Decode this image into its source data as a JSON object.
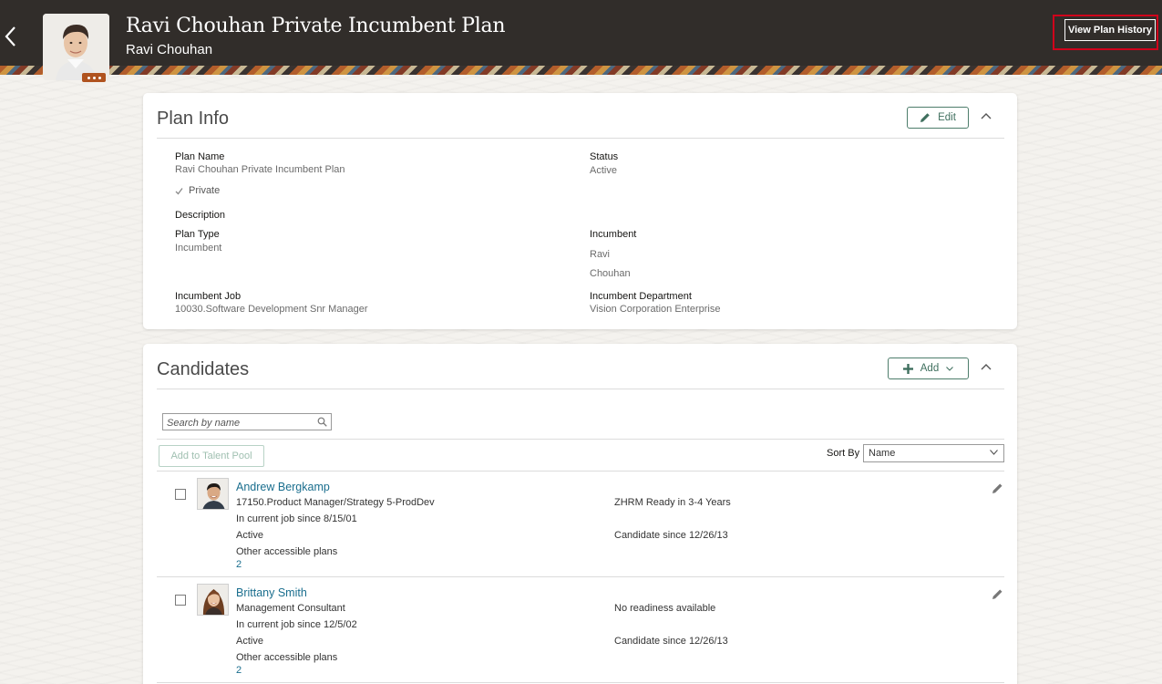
{
  "header": {
    "title": "Ravi Chouhan Private Incumbent Plan",
    "subtitle": "Ravi Chouhan",
    "view_history_label": "View Plan History",
    "back_icon": "chevron-left-icon",
    "more_icon": "ellipsis-icon",
    "highlight_color": "#d0021b"
  },
  "plan_info": {
    "title": "Plan Info",
    "edit_label": "Edit",
    "fields": {
      "plan_name_label": "Plan Name",
      "plan_name_value": "Ravi Chouhan Private Incumbent Plan",
      "status_label": "Status",
      "status_value": "Active",
      "private_label": "Private",
      "description_label": "Description",
      "plan_type_label": "Plan Type",
      "plan_type_value": "Incumbent",
      "incumbent_label": "Incumbent",
      "incumbent_first": "Ravi",
      "incumbent_last": "Chouhan",
      "incumbent_job_label": "Incumbent Job",
      "incumbent_job_value": "10030.Software Development Snr Manager",
      "incumbent_dept_label": "Incumbent Department",
      "incumbent_dept_value": "Vision Corporation Enterprise"
    }
  },
  "candidates": {
    "title": "Candidates",
    "add_label": "Add",
    "search_placeholder": "Search by name",
    "add_to_pool_label": "Add to Talent Pool",
    "sort_label": "Sort By",
    "sort_value": "Name",
    "rows": [
      {
        "name": "Andrew Bergkamp",
        "job": "17150.Product Manager/Strategy 5-ProdDev",
        "job_since": "In current job since 8/15/01",
        "status": "Active",
        "other_plans_label": "Other accessible plans",
        "other_plans_count": "2",
        "readiness": "ZHRM Ready in 3-4 Years",
        "candidate_since": "Candidate since 12/26/13"
      },
      {
        "name": "Brittany Smith",
        "job": "Management Consultant",
        "job_since": "In current job since 12/5/02",
        "status": "Active",
        "other_plans_label": "Other accessible plans",
        "other_plans_count": "2",
        "readiness": "No readiness available",
        "candidate_since": "Candidate since 12/26/13"
      }
    ]
  }
}
